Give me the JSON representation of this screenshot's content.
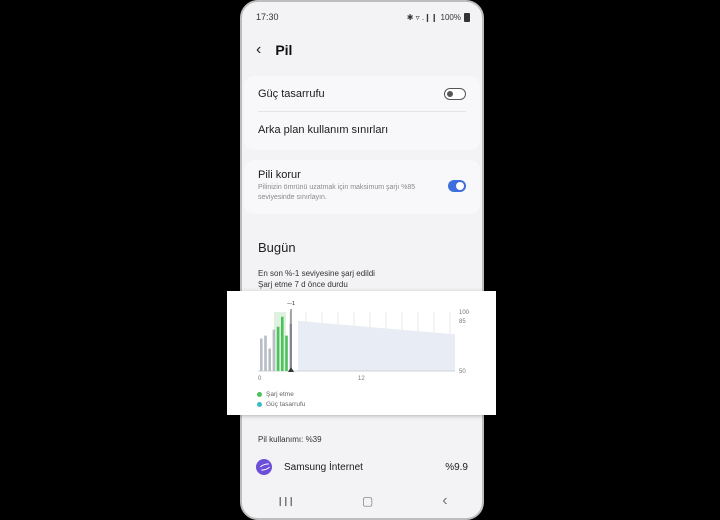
{
  "status": {
    "time": "17:30",
    "icons": "✱ ▿ .❙❙",
    "battery": "100%"
  },
  "header": {
    "title": "Pil",
    "back_icon": "‹"
  },
  "settings": {
    "power_saving": {
      "label": "Güç tasarrufu",
      "enabled": false
    },
    "background_limits": {
      "label": "Arka plan kullanım sınırları"
    },
    "protect_battery": {
      "label": "Pili korur",
      "description": "Pilinizin ömrünü uzatmak için maksimum şarjı %85 seviyesinde sınırlayın.",
      "enabled": true
    }
  },
  "today": {
    "title": "Bugün",
    "line1": "En son %-1 seviyesine şarj edildi",
    "line2": "Şarj etme 7 d önce durdu"
  },
  "chart_data": {
    "type": "bar",
    "x_ticks": [
      "0",
      "12"
    ],
    "y_ticks": [
      "100",
      "85",
      "50"
    ],
    "marker_label": "−-1",
    "series": [
      {
        "name": "Şarj etme",
        "color": "#4cc25a"
      },
      {
        "name": "Güç tasarrufu",
        "color": "#3bbdc8"
      }
    ],
    "bars": [
      {
        "value": 55,
        "type": "gray"
      },
      {
        "value": 60,
        "type": "gray"
      },
      {
        "value": 38,
        "type": "gray"
      },
      {
        "value": 70,
        "type": "gray"
      },
      {
        "value": 75,
        "type": "green"
      },
      {
        "value": 92,
        "type": "green"
      },
      {
        "value": 60,
        "type": "green"
      },
      {
        "value": 80,
        "type": "gray"
      }
    ],
    "projection_start": 85,
    "projection_end": 62
  },
  "usage": {
    "title": "Pil kullanımı: %39"
  },
  "apps": [
    {
      "name": "Samsung İnternet",
      "percent": "%9.9",
      "icon": "samsung-internet-icon"
    }
  ],
  "nav": {
    "recents": "❙❙❙",
    "home": "▢",
    "back": "‹"
  }
}
